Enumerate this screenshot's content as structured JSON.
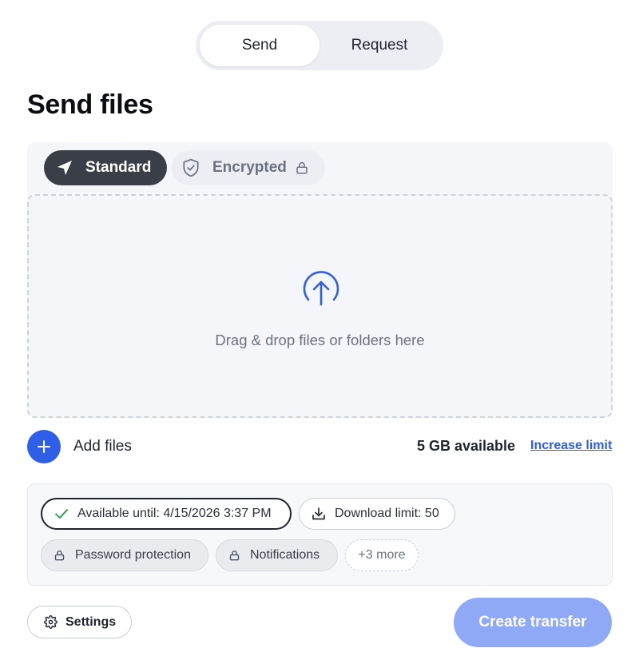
{
  "tabs": {
    "send": "Send",
    "request": "Request",
    "selected": "Send"
  },
  "title": "Send files",
  "modes": {
    "standard": {
      "label": "Standard",
      "icon": "send-plane-icon"
    },
    "encrypted": {
      "label": "Encrypted",
      "icon": "shield-check-icon",
      "lock_icon": "lock-icon"
    },
    "selected": "Standard"
  },
  "dropzone": {
    "text": "Drag & drop files or folders here",
    "icon": "upload-arrow-icon"
  },
  "add_files": {
    "label": "Add files",
    "icon": "plus-icon"
  },
  "storage": {
    "available": "5 GB available",
    "increase_link": "Increase limit"
  },
  "options": {
    "available_until": "Available until: 4/15/2026 3:37 PM",
    "download_limit": "Download limit: 50",
    "password_protection": "Password protection",
    "notifications": "Notifications",
    "more": "+3 more"
  },
  "settings_label": "Settings",
  "create_label": "Create transfer",
  "colors": {
    "accent": "#2f5fe8",
    "create_button": "#8fa9f6",
    "standard_active": "#3a3f47",
    "check": "#16a34a"
  }
}
